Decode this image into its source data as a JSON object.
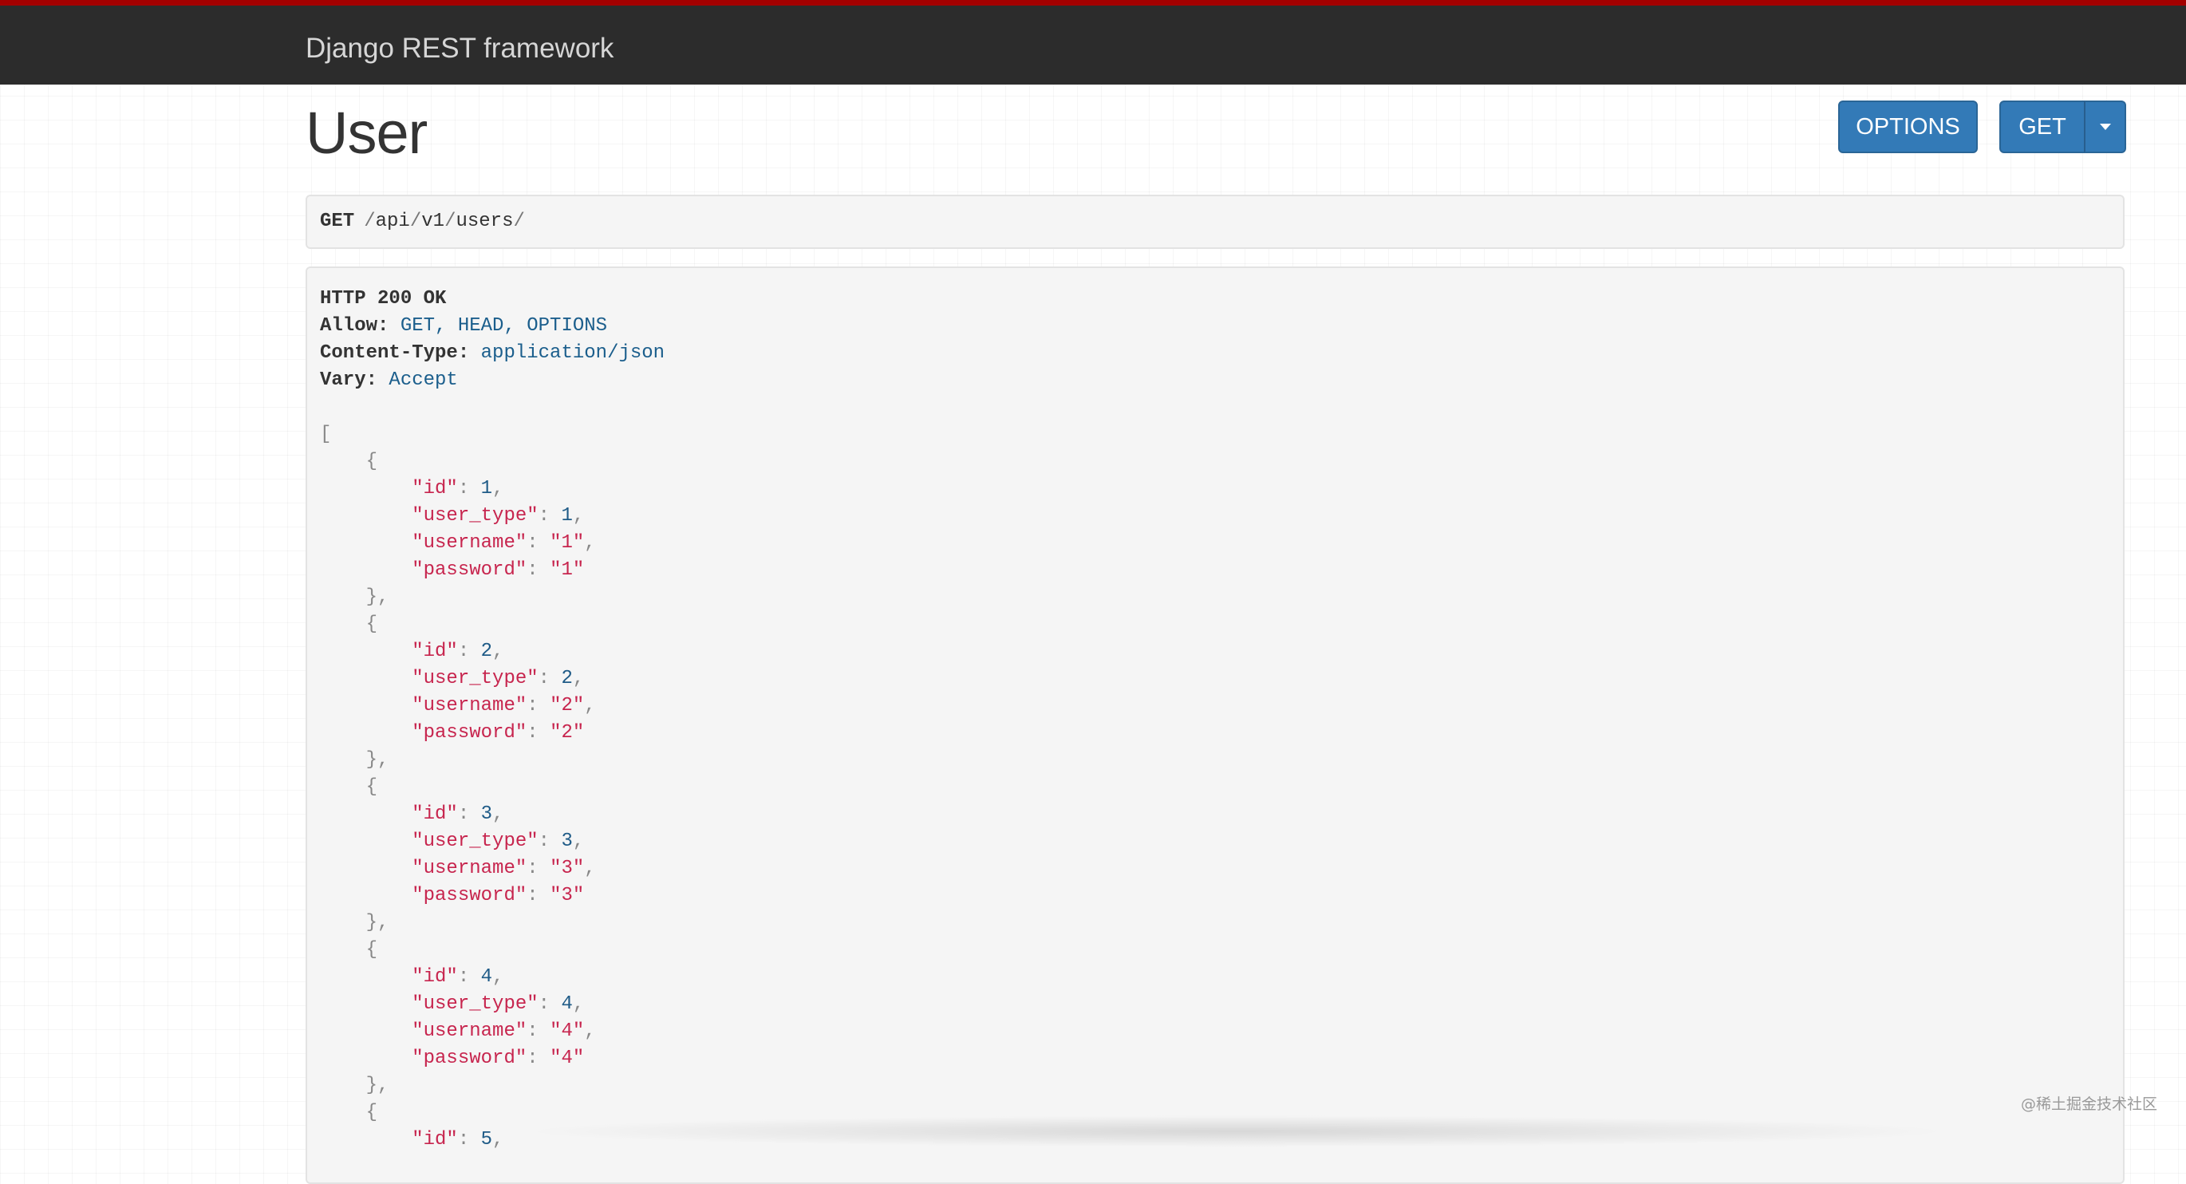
{
  "navbar": {
    "brand": "Django REST framework"
  },
  "page": {
    "title": "User"
  },
  "buttons": {
    "options_label": "OPTIONS",
    "get_label": "GET"
  },
  "request": {
    "method": "GET",
    "path_segments": [
      "api",
      "v1",
      "users"
    ]
  },
  "response": {
    "status": "HTTP 200 OK",
    "headers": [
      {
        "name": "Allow:",
        "value": "GET, HEAD, OPTIONS"
      },
      {
        "name": "Content-Type:",
        "value": "application/json"
      },
      {
        "name": "Vary:",
        "value": "Accept"
      }
    ],
    "body": [
      {
        "id": "1",
        "user_type": "1",
        "username": "\"1\"",
        "password": "\"1\""
      },
      {
        "id": "2",
        "user_type": "2",
        "username": "\"2\"",
        "password": "\"2\""
      },
      {
        "id": "3",
        "user_type": "3",
        "username": "\"3\"",
        "password": "\"3\""
      },
      {
        "id": "4",
        "user_type": "4",
        "username": "\"4\"",
        "password": "\"4\""
      },
      {
        "id": "5"
      }
    ],
    "json_keys": {
      "id": "\"id\"",
      "user_type": "\"user_type\"",
      "username": "\"username\"",
      "password": "\"password\""
    }
  },
  "watermark": "@稀土掘金技术社区",
  "colors": {
    "navbar_bg": "#2c2c2c",
    "navbar_accent": "#a30000",
    "button_primary": "#337ab7",
    "json_string": "#c7254e",
    "json_number": "#1f5b87",
    "header_value": "#1b5e8c"
  },
  "icons": {
    "dropdown": "caret-down-icon"
  }
}
